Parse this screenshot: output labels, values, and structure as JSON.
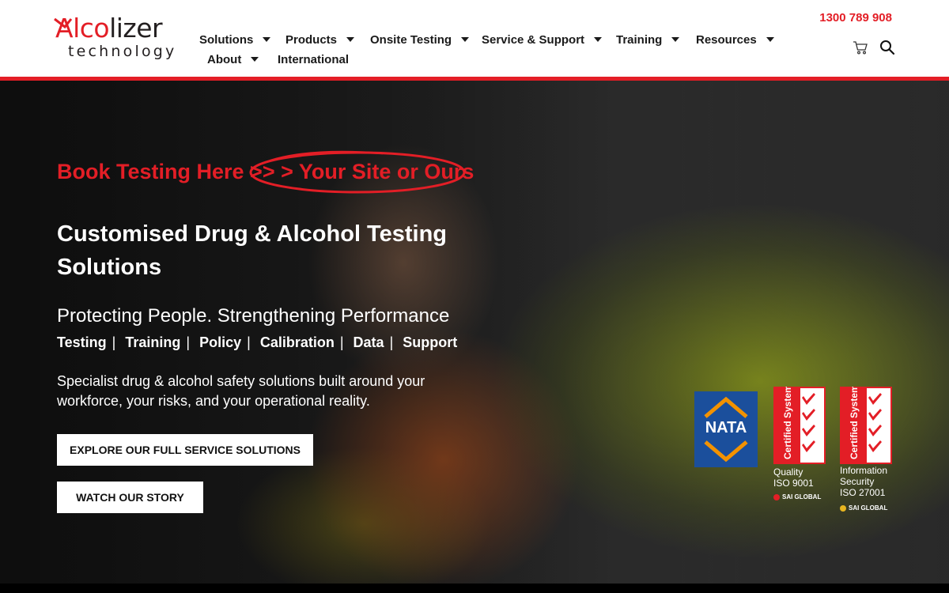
{
  "header": {
    "logo": {
      "main_red": "Alco",
      "main_dark": "lizer",
      "sub": "technology"
    },
    "phone": "1300 789 908",
    "nav": [
      {
        "label": "Solutions",
        "has_caret": true
      },
      {
        "label": "Products",
        "has_caret": true
      },
      {
        "label": "Onsite Testing",
        "has_caret": true
      },
      {
        "label": "Service & Support",
        "has_caret": true
      },
      {
        "label": "Training",
        "has_caret": true
      },
      {
        "label": "Resources",
        "has_caret": true
      },
      {
        "label": "About",
        "has_caret": true
      },
      {
        "label": "International",
        "has_caret": false
      }
    ],
    "icons": [
      "cart-icon",
      "search-icon"
    ]
  },
  "hero": {
    "book_prefix": "Book Testing Here >",
    "book_link": "> > Your Site or Ours",
    "heading": "Customised Drug & Alcohol Testing Solutions",
    "subheading": "Protecting People. Strengthening Performance",
    "tags": [
      "Testing",
      "Training",
      "Policy",
      "Calibration",
      "Data",
      "Support"
    ],
    "tag_separator": "|",
    "description": "Specialist drug & alcohol safety solutions built around your workforce, your risks, and your operational reality.",
    "buttons": {
      "explore": "Explore Our Full Service Solutions",
      "story": "Watch Our Story"
    }
  },
  "certifications": {
    "nata": "NATA",
    "cert_label": "Certified System",
    "quality": {
      "line1": "Quality",
      "line2": "ISO 9001",
      "org": "SAI GLOBAL"
    },
    "security": {
      "line1": "Information",
      "line2": "Security",
      "line3": "ISO 27001",
      "org": "SAI GLOBAL"
    }
  },
  "colors": {
    "brand_red": "#e31e26",
    "nata_blue": "#1b4f9c",
    "nata_orange": "#f39200"
  }
}
